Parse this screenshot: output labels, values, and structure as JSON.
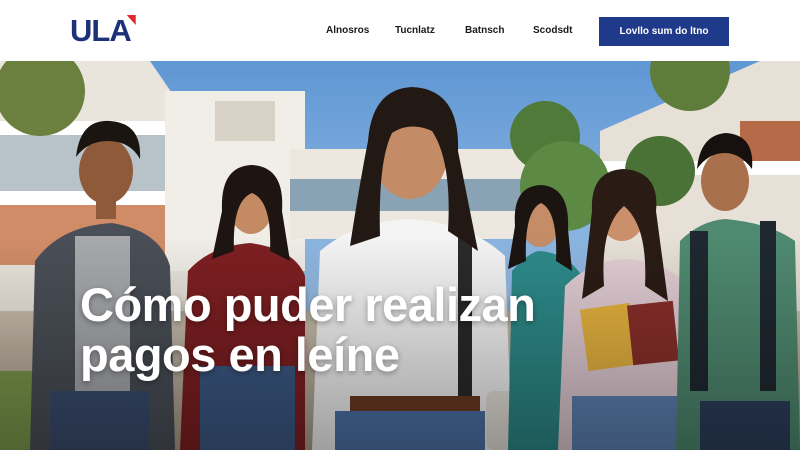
{
  "header": {
    "logo_text": "ULA",
    "nav": [
      "Alnosros",
      "Tucnlatz",
      "Batnsch",
      "Scodsdt"
    ],
    "cta_label": "Lovllo sum do ltno"
  },
  "hero": {
    "title_line1": "Cómo puder realizan",
    "title_line2": "pagos en leíne"
  },
  "colors": {
    "brand_blue": "#1f3a8a",
    "logo_blue": "#1c3178",
    "logo_red": "#e0272b",
    "sky": "#6fa3d8"
  }
}
